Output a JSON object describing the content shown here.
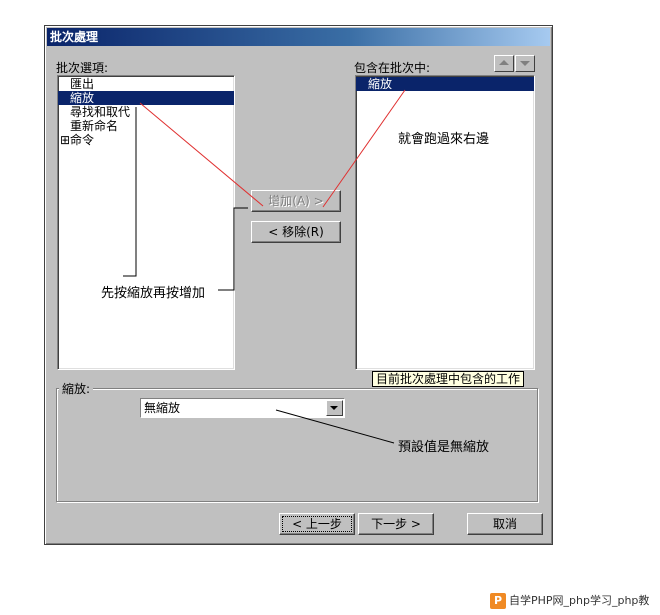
{
  "dialog": {
    "title": "批次處理",
    "options_label": "批次選項:",
    "included_label": "包含在批次中:",
    "options": [
      {
        "label": "匯出",
        "selected": false,
        "expandable": false
      },
      {
        "label": "縮放",
        "selected": true,
        "expandable": false
      },
      {
        "label": "尋找和取代",
        "selected": false,
        "expandable": false
      },
      {
        "label": "重新命名",
        "selected": false,
        "expandable": false
      },
      {
        "label": "命令",
        "selected": false,
        "expandable": true
      }
    ],
    "included": [
      {
        "label": "縮放",
        "selected": true
      }
    ],
    "add_button": "增加(A) >",
    "remove_button": "< 移除(R)",
    "group_label": "縮放:",
    "scale_select_value": "無縮放",
    "tooltip": "目前批次處理中包含的工作",
    "back_button": "< 上一步",
    "next_button": "下一步 >",
    "cancel_button": "取消"
  },
  "annotations": {
    "press_first": "先按縮放再按增加",
    "moves_right": "就會跑過來右邊",
    "default_value": "預設值是無縮放"
  },
  "watermark": {
    "logo_letter": "P",
    "text": "自学PHP网_php学习_php教"
  },
  "colors": {
    "dialog_bg": "#c0c0c0",
    "selection": "#0a246a",
    "annotation_line": "#e03030"
  },
  "icons": {
    "plus": "⊞"
  }
}
